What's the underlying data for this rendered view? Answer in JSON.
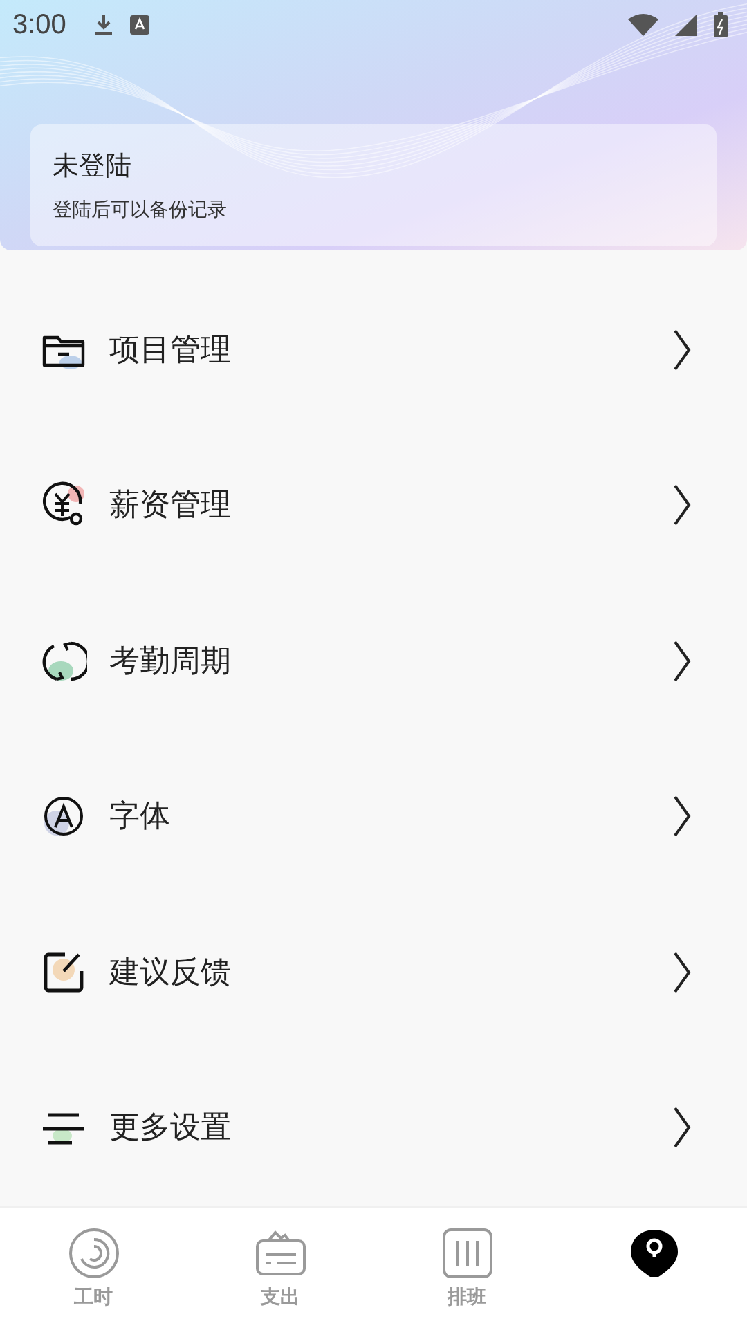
{
  "status_bar": {
    "time": "3:00"
  },
  "account": {
    "title": "未登陆",
    "subtitle": "登陆后可以备份记录"
  },
  "menu": [
    {
      "kind": "folder",
      "label": "项目管理"
    },
    {
      "kind": "salary",
      "label": "薪资管理"
    },
    {
      "kind": "cycle",
      "label": "考勤周期"
    },
    {
      "kind": "font",
      "label": "字体"
    },
    {
      "kind": "feedback",
      "label": "建议反馈"
    },
    {
      "kind": "settings",
      "label": "更多设置"
    }
  ],
  "tabs": [
    {
      "kind": "clock",
      "label": "工时",
      "selected": false
    },
    {
      "kind": "wallet",
      "label": "支出",
      "selected": false
    },
    {
      "kind": "schedule",
      "label": "排班",
      "selected": false
    },
    {
      "kind": "me",
      "selected": true
    }
  ]
}
